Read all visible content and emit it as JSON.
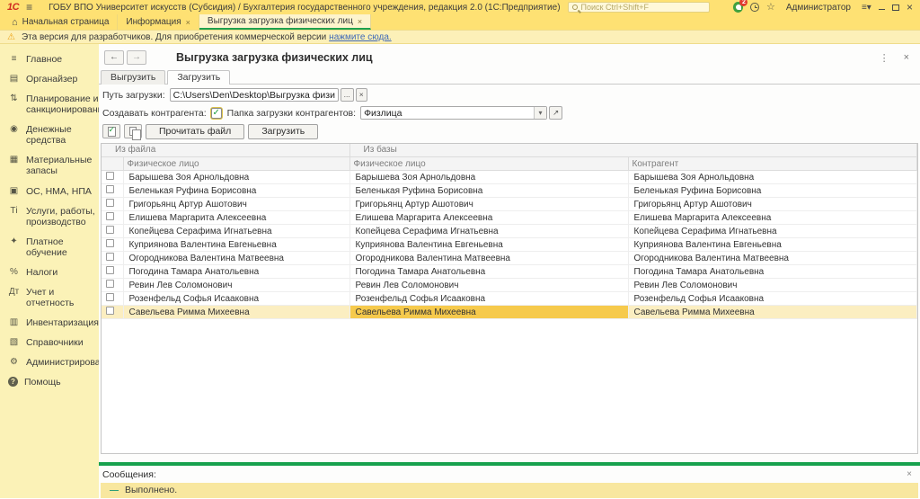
{
  "window": {
    "logo": "1С",
    "title": "ГОБУ ВПО Университет искусств (Субсидия) / Бухгалтерия государственного учреждения, редакция 2.0  (1С:Предприятие)",
    "search_placeholder": "Поиск Ctrl+Shift+F",
    "notification_count": "2",
    "user": "Администратор"
  },
  "tabs": [
    {
      "label": "Начальная страница",
      "icon": "home",
      "closable": false,
      "active": false
    },
    {
      "label": "Информация",
      "closable": true,
      "active": false
    },
    {
      "label": "Выгрузка загрузка физических лиц",
      "closable": true,
      "active": true
    }
  ],
  "warning": {
    "text": "Эта версия для разработчиков. Для приобретения коммерческой версии",
    "link": "нажмите сюда."
  },
  "sidebar": {
    "items": [
      {
        "label": "Главное",
        "icon": "menu"
      },
      {
        "label": "Органайзер",
        "icon": "organizer"
      },
      {
        "label": "Планирование и санкционирование",
        "icon": "planning"
      },
      {
        "label": "Денежные средства",
        "icon": "money"
      },
      {
        "label": "Материальные запасы",
        "icon": "materials"
      },
      {
        "label": "ОС, НМА, НПА",
        "icon": "assets"
      },
      {
        "label": "Услуги, работы, производство",
        "icon": "services"
      },
      {
        "label": "Платное обучение",
        "icon": "education"
      },
      {
        "label": "Налоги",
        "icon": "taxes"
      },
      {
        "label": "Учет и отчетность",
        "icon": "accounting"
      },
      {
        "label": "Инвентаризация",
        "icon": "inventory"
      },
      {
        "label": "Справочники",
        "icon": "reference"
      },
      {
        "label": "Администрирование",
        "icon": "admin"
      },
      {
        "label": "Помощь",
        "icon": "help"
      }
    ]
  },
  "form": {
    "title": "Выгрузка загрузка физических лиц",
    "tabs": [
      {
        "label": "Выгрузить",
        "active": false
      },
      {
        "label": "Загрузить",
        "active": true
      }
    ],
    "path_label": "Путь загрузки:",
    "path_value": "C:\\Users\\Den\\Desktop\\Выгрузка физических лиц.xml",
    "create_contractor_label": "Создавать контрагента:",
    "create_contractor_checked": true,
    "folder_label": "Папка загрузки контрагентов:",
    "folder_value": "Физлица",
    "buttons": {
      "read_file": "Прочитать файл",
      "load": "Загрузить"
    }
  },
  "table": {
    "group_headers": [
      "Из файла",
      "Из базы"
    ],
    "columns": [
      "Физическое лицо",
      "Физическое лицо",
      "Контрагент"
    ],
    "selected_row_index": 10,
    "selected_column": "from_base",
    "rows": [
      {
        "from_file": "Барышева Зоя Арнольдовна",
        "from_base": "Барышева Зоя Арнольдовна",
        "contractor": "Барышева Зоя Арнольдовна"
      },
      {
        "from_file": "Беленькая Руфина Борисовна",
        "from_base": "Беленькая Руфина Борисовна",
        "contractor": "Беленькая Руфина Борисовна"
      },
      {
        "from_file": "Григорьянц Артур Ашотович",
        "from_base": "Григорьянц Артур Ашотович",
        "contractor": "Григорьянц Артур Ашотович"
      },
      {
        "from_file": "Елишева Маргарита Алексеевна",
        "from_base": "Елишева Маргарита Алексеевна",
        "contractor": "Елишева Маргарита Алексеевна"
      },
      {
        "from_file": "Копейцева Серафима Игнатьевна",
        "from_base": "Копейцева Серафима Игнатьевна",
        "contractor": "Копейцева Серафима Игнатьевна"
      },
      {
        "from_file": "Куприянова Валентина Евгеньевна",
        "from_base": "Куприянова Валентина Евгеньевна",
        "contractor": "Куприянова Валентина Евгеньевна"
      },
      {
        "from_file": "Огородникова Валентина Матвеевна",
        "from_base": "Огородникова Валентина Матвеевна",
        "contractor": "Огородникова Валентина Матвеевна"
      },
      {
        "from_file": "Погодина Тамара Анатольевна",
        "from_base": "Погодина Тамара Анатольевна",
        "contractor": "Погодина Тамара Анатольевна"
      },
      {
        "from_file": "Ревин Лев Соломонович",
        "from_base": "Ревин Лев Соломонович",
        "contractor": "Ревин Лев Соломонович"
      },
      {
        "from_file": "Розенфельд Софья Исааковна",
        "from_base": "Розенфельд Софья Исааковна",
        "contractor": "Розенфельд Софья Исааковна"
      },
      {
        "from_file": "Савельева Римма Михеевна",
        "from_base": "Савельева Римма Михеевна",
        "contractor": "Савельева Римма Михеевна"
      }
    ]
  },
  "messages": {
    "title": "Сообщения:",
    "items": [
      {
        "icon": "dash",
        "text": "Выполнено."
      }
    ]
  }
}
